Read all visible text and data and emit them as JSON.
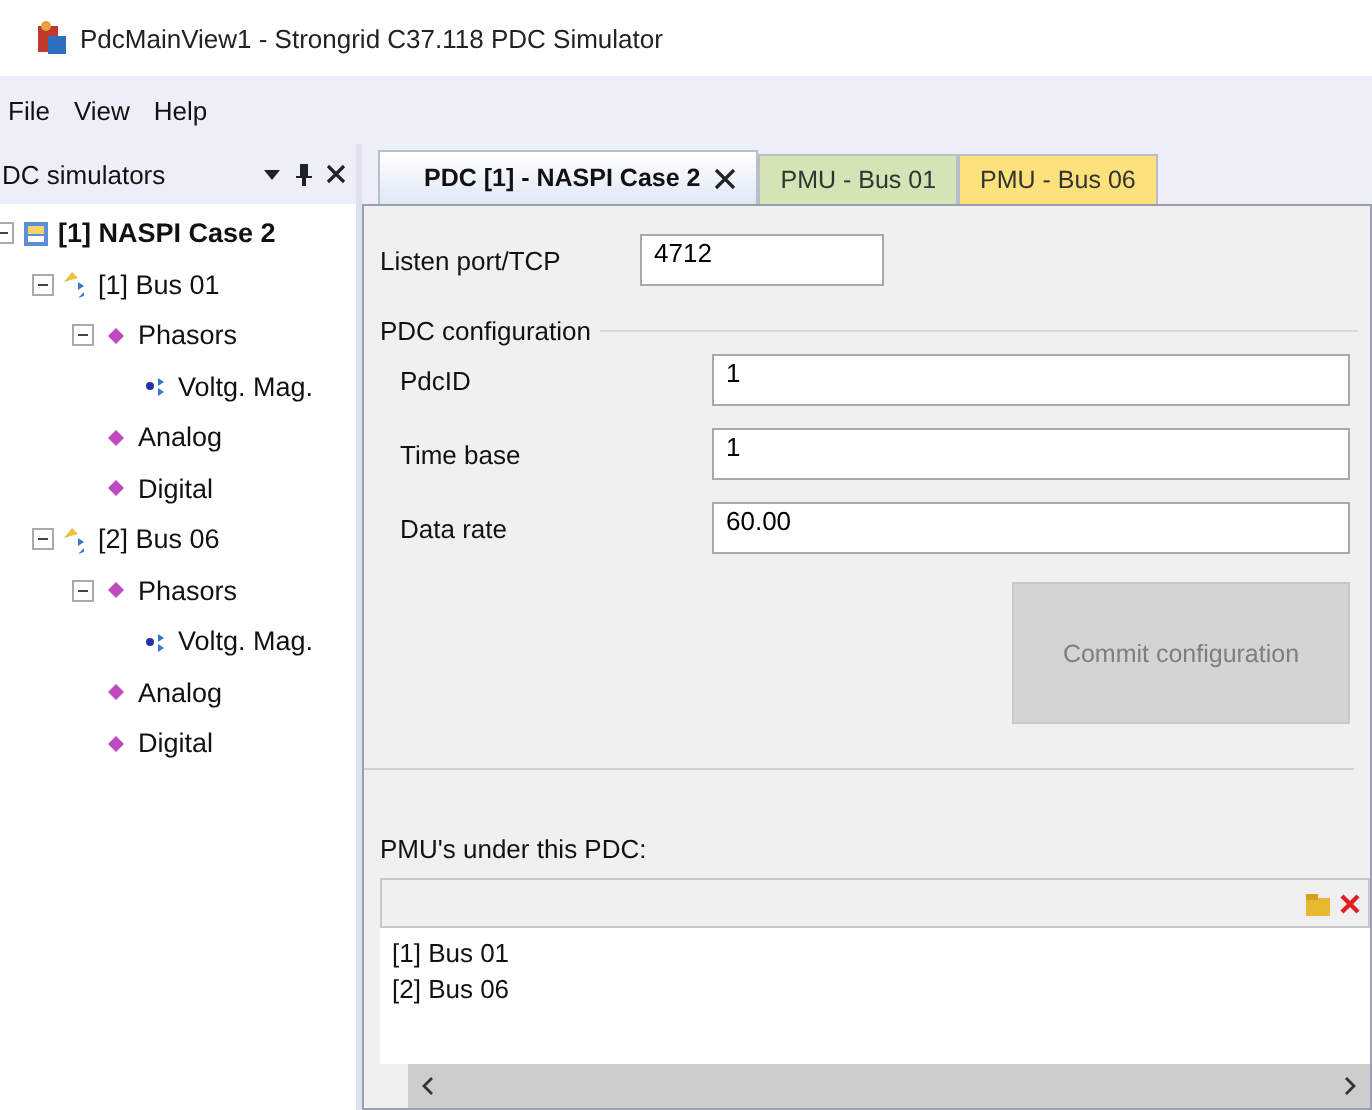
{
  "window": {
    "title": "PdcMainView1 - Strongrid C37.118 PDC Simulator"
  },
  "menu": [
    "File",
    "View",
    "Help"
  ],
  "sidebar": {
    "title": "DC simulators",
    "tree": [
      {
        "label": "[1] NASPI Case 2",
        "kind": "root",
        "expanded": true,
        "children": [
          {
            "label": "[1] Bus 01",
            "kind": "pmu",
            "expanded": true,
            "children": [
              {
                "label": "Phasors",
                "kind": "group",
                "expanded": true,
                "children": [
                  {
                    "label": "Voltg. Mag.",
                    "kind": "channel"
                  }
                ]
              },
              {
                "label": "Analog",
                "kind": "group"
              },
              {
                "label": "Digital",
                "kind": "group"
              }
            ]
          },
          {
            "label": "[2] Bus 06",
            "kind": "pmu",
            "expanded": true,
            "children": [
              {
                "label": "Phasors",
                "kind": "group",
                "expanded": true,
                "children": [
                  {
                    "label": "Voltg. Mag.",
                    "kind": "channel"
                  }
                ]
              },
              {
                "label": "Analog",
                "kind": "group"
              },
              {
                "label": "Digital",
                "kind": "group"
              }
            ]
          }
        ]
      }
    ]
  },
  "tabs": [
    {
      "label": "PDC [1] - NASPI Case 2",
      "selected": true,
      "closable": true,
      "color": "#dfe8f6"
    },
    {
      "label": "PMU - Bus 01",
      "selected": false,
      "closable": false,
      "color": "#d3e5b5"
    },
    {
      "label": "PMU - Bus 06",
      "selected": false,
      "closable": false,
      "color": "#fde27c"
    }
  ],
  "listen_port": {
    "label": "Listen port/TCP",
    "value": "4712"
  },
  "pdc_configuration": {
    "title": "PDC configuration",
    "fields": [
      {
        "label": "PdcID",
        "value": "1"
      },
      {
        "label": "Time base",
        "value": "1"
      },
      {
        "label": "Data rate",
        "value": "60.00"
      }
    ],
    "commit_button": {
      "label": "Commit configuration",
      "disabled": true
    }
  },
  "pmus": {
    "label": "PMU's under this PDC:",
    "items": [
      "[1] Bus 01",
      "[2] Bus 06"
    ]
  }
}
